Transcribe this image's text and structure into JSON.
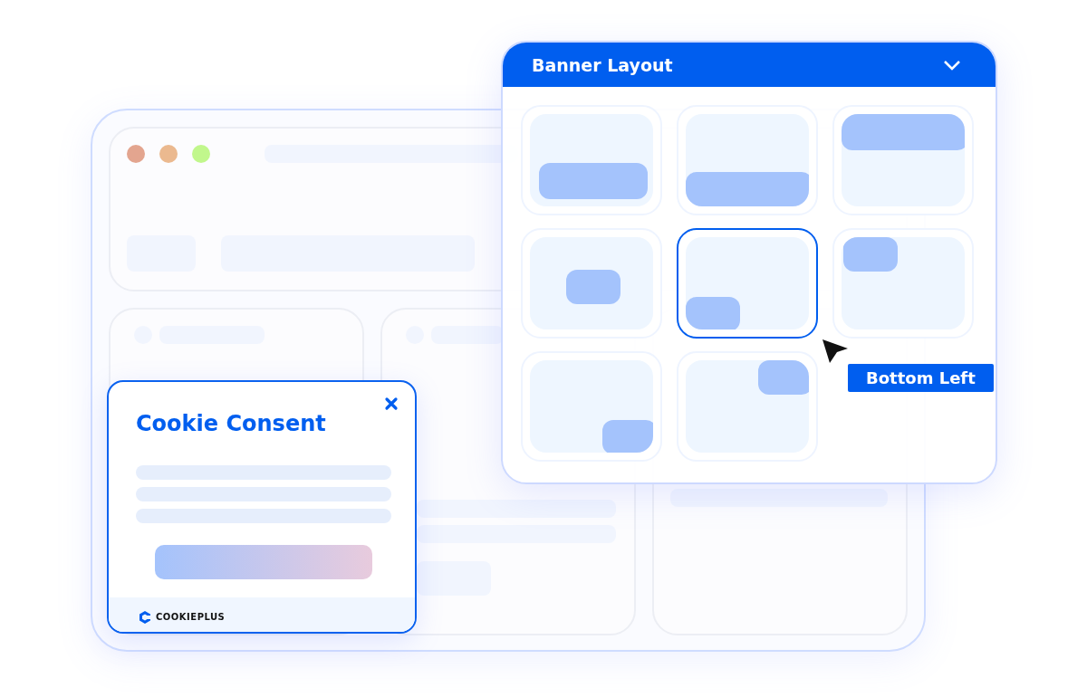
{
  "banner_layout": {
    "title": "Banner Layout",
    "expanded": true,
    "options": [
      {
        "kind": "bottom-inset",
        "selected": false
      },
      {
        "kind": "bottom-full",
        "selected": false
      },
      {
        "kind": "top-full",
        "selected": false
      },
      {
        "kind": "center",
        "selected": false
      },
      {
        "kind": "bottom-left",
        "selected": true
      },
      {
        "kind": "top-left",
        "selected": false
      },
      {
        "kind": "bottom-right",
        "selected": false
      },
      {
        "kind": "top-right",
        "selected": false
      }
    ],
    "tooltip": "Bottom Left"
  },
  "cookie_dialog": {
    "title": "Cookie Consent",
    "brand": "COOKIEPLUS"
  }
}
